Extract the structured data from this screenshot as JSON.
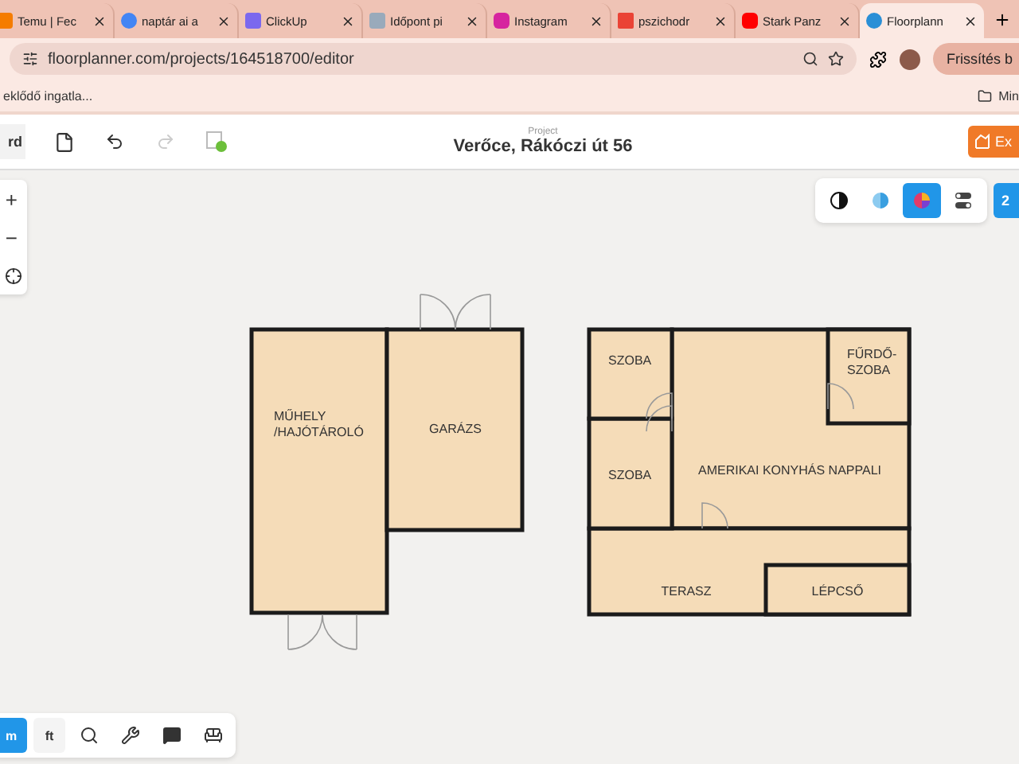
{
  "browser": {
    "tabs": [
      {
        "title": "Temu | Fec",
        "kind": "temu",
        "selected": false
      },
      {
        "title": "naptár ai a",
        "kind": "google",
        "selected": false
      },
      {
        "title": "ClickUp",
        "kind": "clickup",
        "selected": false
      },
      {
        "title": "Időpont pi",
        "kind": "page",
        "selected": false
      },
      {
        "title": "Instagram",
        "kind": "instagram",
        "selected": false
      },
      {
        "title": "pszichodr",
        "kind": "gmail",
        "selected": false
      },
      {
        "title": "Stark Panz",
        "kind": "youtube",
        "selected": false
      },
      {
        "title": "Floorplann",
        "kind": "floorplanner",
        "selected": true
      }
    ],
    "address": "floorplanner.com/projects/164518700/editor",
    "update_button": "Frissítés b",
    "bookmarks": [
      "eklődő ingatla...",
      "Min"
    ]
  },
  "toolbar": {
    "left_button": "rd",
    "actions": [
      {
        "kind": "new",
        "disabled": false
      },
      {
        "kind": "undo",
        "disabled": false
      },
      {
        "kind": "redo",
        "disabled": true
      },
      {
        "kind": "save",
        "disabled": false
      }
    ],
    "project_label": "Project",
    "project_title": "Verőce, Rákóczi út 56",
    "export_button": "Ex"
  },
  "view_modes": [
    {
      "kind": "contrast",
      "selected": false
    },
    {
      "kind": "half",
      "selected": false
    },
    {
      "kind": "color",
      "selected": true
    },
    {
      "kind": "toggles",
      "selected": false
    }
  ],
  "level_button": "2",
  "zoom": [
    "+",
    "−"
  ],
  "units": [
    {
      "label": "m",
      "selected": true
    },
    {
      "label": "ft",
      "selected": false
    }
  ],
  "rooms": [
    {
      "lines": [
        "MŰHELY",
        "/HAJÓTÁROLÓ"
      ]
    },
    {
      "lines": [
        "GARÁZS"
      ]
    },
    {
      "lines": [
        "SZOBA"
      ]
    },
    {
      "lines": [
        "FŰRDŐ-",
        "SZOBA"
      ]
    },
    {
      "lines": [
        "SZOBA"
      ]
    },
    {
      "lines": [
        "AMERIKAI KONYHÁS NAPPALI"
      ]
    },
    {
      "lines": [
        "TERASZ"
      ]
    },
    {
      "lines": [
        "LÉPCSŐ"
      ]
    }
  ]
}
